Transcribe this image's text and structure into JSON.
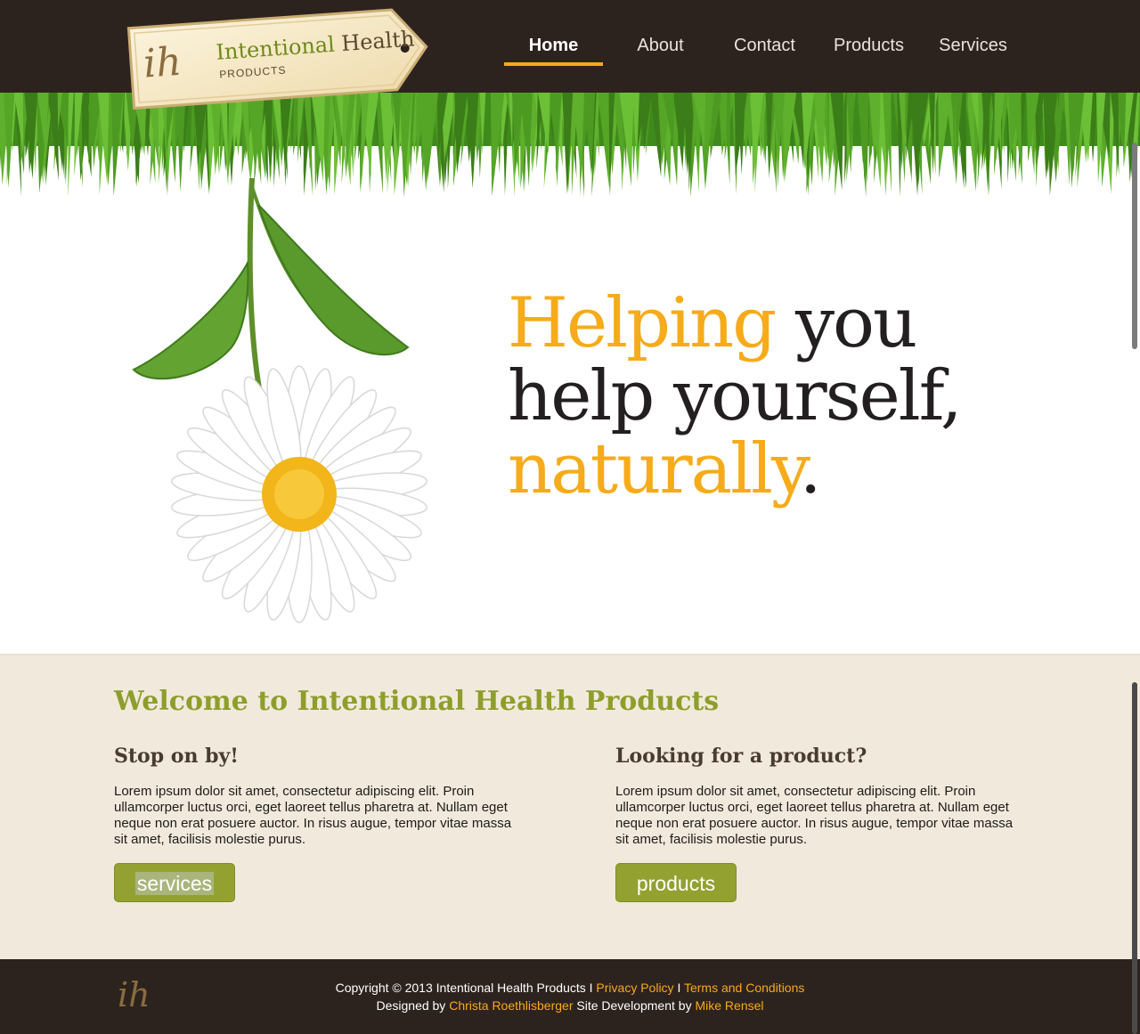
{
  "header": {
    "logo": {
      "mark": "ih",
      "name_primary": "Intentional",
      "name_secondary": "Health",
      "sub": "PRODUCTS"
    },
    "nav": [
      {
        "label": "Home",
        "active": true
      },
      {
        "label": "About",
        "active": false
      },
      {
        "label": "Contact",
        "active": false
      },
      {
        "label": "Products",
        "active": false
      },
      {
        "label": "Services",
        "active": false
      }
    ]
  },
  "hero": {
    "word1": "Helping",
    "word2": " you",
    "line2": "help yourself,",
    "word3": "naturally",
    "period": "."
  },
  "welcome": {
    "title": "Welcome to Intentional Health Products",
    "left": {
      "heading": "Stop on by!",
      "body": "Lorem ipsum dolor sit amet, consectetur adipiscing elit. Proin ullamcorper luctus orci, eget laoreet tellus pharetra at. Nullam eget neque non erat posuere auctor. In risus augue, tempor vitae massa sit amet, facilisis molestie purus.",
      "button": "services"
    },
    "right": {
      "heading": "Looking for a product?",
      "body": "Lorem ipsum dolor sit amet, consectetur adipiscing elit. Proin ullamcorper luctus orci, eget laoreet tellus pharetra at. Nullam eget neque non erat posuere auctor. In risus augue, tempor vitae massa sit amet, facilisis molestie purus.",
      "button": "products"
    }
  },
  "footer": {
    "logo": "ih",
    "copyright": "Copyright © 2013 Intentional Health Products",
    "sep1": "  I  ",
    "privacy": "Privacy Policy",
    "sep2": " I ",
    "terms": "Terms and Conditions",
    "designed_by": "Designed by ",
    "designer": "Christa Roethlisberger",
    "site_dev": " Site Development by ",
    "developer": "Mike Rensel"
  },
  "colors": {
    "header_bg": "#2d231e",
    "accent_orange": "#f6ab1a",
    "accent_green": "#93a131",
    "section_bg": "#f1eadc"
  }
}
